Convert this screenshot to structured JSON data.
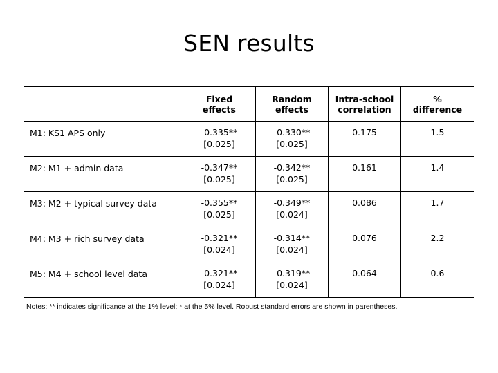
{
  "slide": {
    "title": "SEN results"
  },
  "table": {
    "headers": [
      {
        "line1": "",
        "line2": ""
      },
      {
        "line1": "Fixed",
        "line2": "effects"
      },
      {
        "line1": "Random",
        "line2": "effects"
      },
      {
        "line1": "Intra-school",
        "line2": "correlation"
      },
      {
        "line1": "%",
        "line2": "difference"
      }
    ],
    "rows": [
      {
        "label": "M1: KS1 APS only",
        "fixed_effects": {
          "coefficient": "-0.335**",
          "std_error": "[0.025]"
        },
        "random_effects": {
          "coefficient": "-0.330**",
          "std_error": "[0.025]"
        },
        "intra_school_correlation": "0.175",
        "percent_difference": "1.5"
      },
      {
        "label": "M2: M1 + admin data",
        "fixed_effects": {
          "coefficient": "-0.347**",
          "std_error": "[0.025]"
        },
        "random_effects": {
          "coefficient": "-0.342**",
          "std_error": "[0.025]"
        },
        "intra_school_correlation": "0.161",
        "percent_difference": "1.4"
      },
      {
        "label": "M3: M2 + typical survey data",
        "fixed_effects": {
          "coefficient": "-0.355**",
          "std_error": "[0.025]"
        },
        "random_effects": {
          "coefficient": "-0.349**",
          "std_error": "[0.024]"
        },
        "intra_school_correlation": "0.086",
        "percent_difference": "1.7"
      },
      {
        "label": "M4: M3 + rich survey data",
        "fixed_effects": {
          "coefficient": "-0.321**",
          "std_error": "[0.024]"
        },
        "random_effects": {
          "coefficient": "-0.314**",
          "std_error": "[0.024]"
        },
        "intra_school_correlation": "0.076",
        "percent_difference": "2.2"
      },
      {
        "label": "M5: M4 + school level data",
        "fixed_effects": {
          "coefficient": "-0.321**",
          "std_error": "[0.024]"
        },
        "random_effects": {
          "coefficient": "-0.319**",
          "std_error": "[0.024]"
        },
        "intra_school_correlation": "0.064",
        "percent_difference": "0.6"
      }
    ]
  },
  "footnote": {
    "text": "Notes: ** indicates significance at the 1% level; * at the 5% level. Robust standard errors are shown in parentheses."
  }
}
